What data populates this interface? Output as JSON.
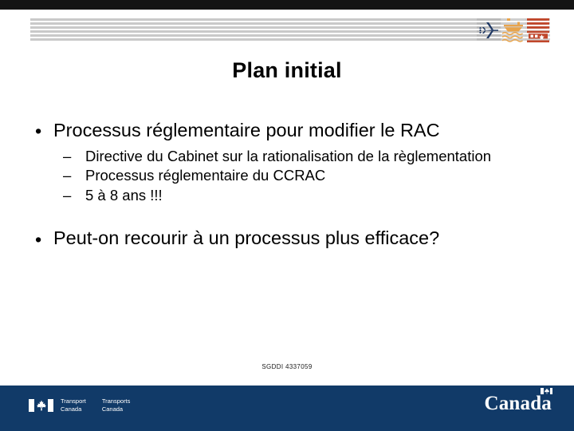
{
  "colors": {
    "top_bar": "#141414",
    "header_rule": "#c9c9c9",
    "footer_bar": "#113a68",
    "air_icon": "#1f3864",
    "marine_icon": "#e8a44c",
    "rail_icon": "#c0462a",
    "text": "#000000",
    "footer_text": "#ffffff"
  },
  "header": {
    "rule_count": 6,
    "icons": [
      {
        "name": "airplane-icon",
        "label": "Air",
        "color": "#1f3864"
      },
      {
        "name": "ship-waves-icon",
        "label": "Marine",
        "color": "#e8a44c"
      },
      {
        "name": "train-road-icon",
        "label": "Rail",
        "color": "#c0462a"
      }
    ]
  },
  "slide": {
    "title": "Plan initial",
    "bullets": [
      {
        "marker": "•",
        "text": "Processus réglementaire pour modifier le RAC",
        "sub_bullets": [
          {
            "marker": "–",
            "text": "Directive du Cabinet sur la rationalisation de la règlementation"
          },
          {
            "marker": "–",
            "text": "Processus réglementaire du CCRAC"
          },
          {
            "marker": "–",
            "text": "5 à 8 ans !!!"
          }
        ]
      },
      {
        "marker": "•",
        "text": "Peut-on recourir à un processus plus efficace?",
        "sub_bullets": []
      }
    ],
    "footnote": "SGDDI 4337059"
  },
  "footer": {
    "signature": {
      "flag_name": "canada-flag-icon",
      "english": {
        "line1": "Transport",
        "line2": "Canada"
      },
      "french": {
        "line1": "Transports",
        "line2": "Canada"
      }
    },
    "wordmark": {
      "text": "Canada",
      "flag_name": "canada-flag-icon"
    }
  }
}
